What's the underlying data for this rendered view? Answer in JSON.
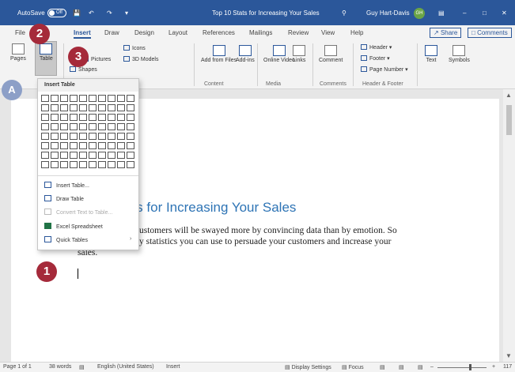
{
  "titlebar": {
    "autosave": "AutoSave",
    "toggle": "Off",
    "doc_title": "Top 10 Stats for Increasing Your Sales",
    "search_icon": "search-icon",
    "user": "Guy Hart-Davis",
    "initials": "GH"
  },
  "tabs": [
    "File",
    "Insert",
    "Draw",
    "Design",
    "Layout",
    "References",
    "Mailings",
    "Review",
    "View",
    "Help"
  ],
  "share": "Share",
  "comments": "Comments",
  "ribbon": {
    "pages": "Pages",
    "table": "Table",
    "pictures": "Pictures",
    "shapes": "Shapes",
    "icons": "Icons",
    "models": "3D Models",
    "addins": "Add from Files",
    "addins2": "Add-ins",
    "online_video": "Online Video",
    "links": "Links",
    "comment": "Comment",
    "header": "Header",
    "footer": "Footer",
    "page_number": "Page Number",
    "text": "Text",
    "symbols": "Symbols",
    "groups": {
      "content": "Content",
      "media": "Media",
      "comments": "Comments",
      "header_footer": "Header & Footer"
    }
  },
  "dropdown": {
    "title": "Insert Table",
    "items": [
      "Insert Table...",
      "Draw Table",
      "Convert Text to Table...",
      "Excel Spreadsheet",
      "Quick Tables"
    ]
  },
  "document": {
    "title": "ats for Increasing Your Sales",
    "line1": "ustomers will be swayed more by convincing data than by emotion. So",
    "line2": "y statistics you can use to persuade your customers and increase your",
    "line3": "sales."
  },
  "status": {
    "page": "Page 1 of 1",
    "words": "38 words",
    "language": "English (United States)",
    "mode": "Insert",
    "display": "Display Settings",
    "focus": "Focus",
    "zoom": "117"
  },
  "callouts": {
    "c1": "1",
    "c2": "2",
    "c3": "3",
    "cA": "A"
  }
}
